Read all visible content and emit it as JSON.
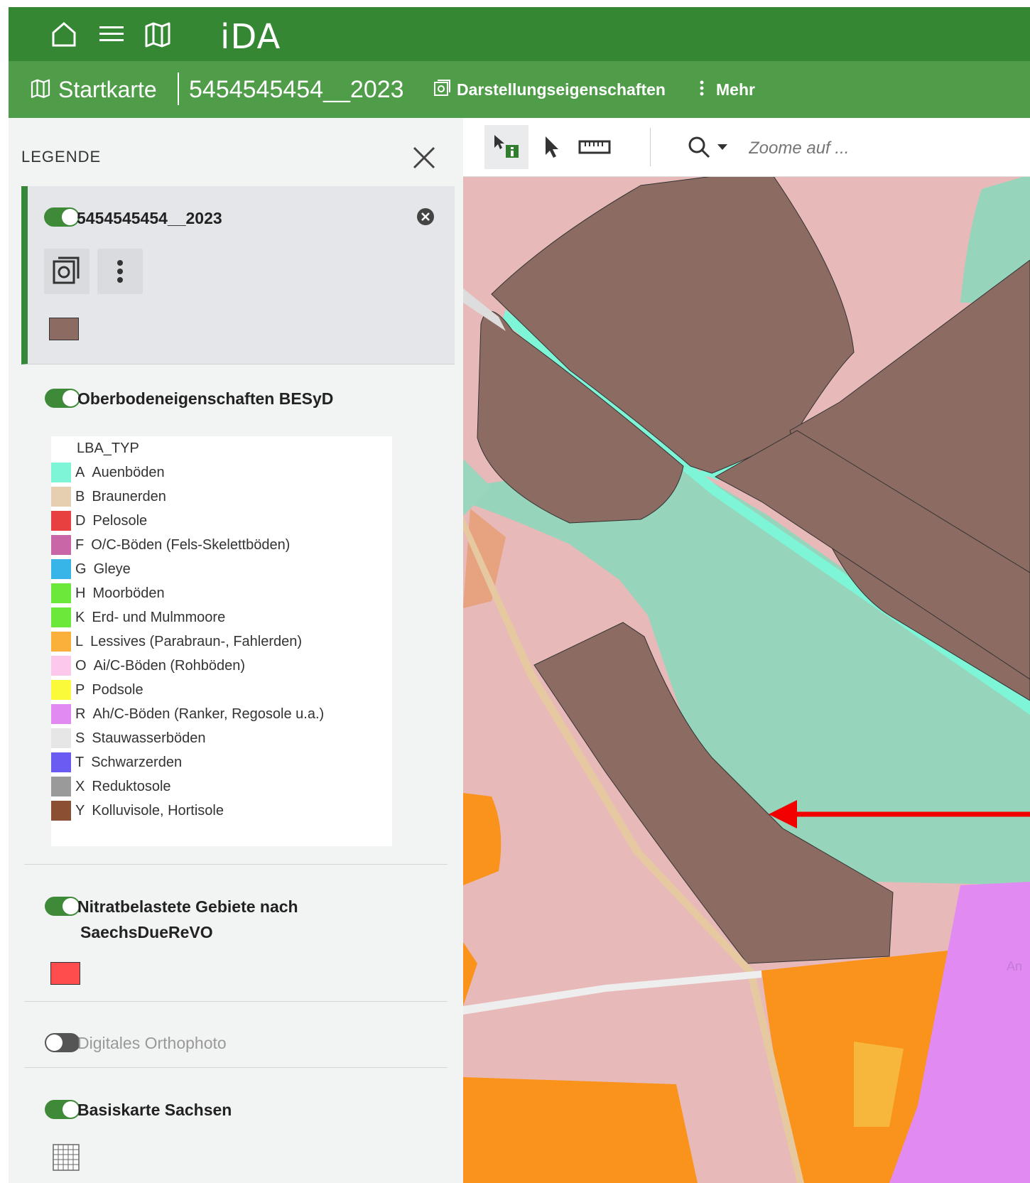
{
  "app": {
    "title": "iDA"
  },
  "topbar": {
    "home_icon": "home-icon",
    "menu_icon": "hamburger-menu-icon",
    "map_icon": "map-icon"
  },
  "subbar": {
    "startkarte": "Startkarte",
    "layer_name": "5454545454__2023",
    "darstellung": "Darstellungseigenschaften",
    "mehr": "Mehr"
  },
  "legend": {
    "title": "LEGENDE",
    "layers": [
      {
        "name": "5454545454__2023",
        "enabled": true,
        "swatch_color": "#8c6b62"
      },
      {
        "name": "Oberbodeneigenschaften BESyD",
        "enabled": true
      },
      {
        "name": "Nitratbelastete Gebiete nach",
        "name_line2": "SaechsDueReVO",
        "enabled": true,
        "swatch_color": "#ff4d4d"
      },
      {
        "name": "Digitales Orthophoto",
        "enabled": false
      },
      {
        "name": "Basiskarte Sachsen",
        "enabled": true
      }
    ],
    "soil_table": {
      "header": "LBA_TYP",
      "rows": [
        {
          "code": "A",
          "label": "Auenböden",
          "color": "#7ff5d8"
        },
        {
          "code": "B",
          "label": "Braunerden",
          "color": "#e5cfb0"
        },
        {
          "code": "D",
          "label": "Pelosole",
          "color": "#e84040"
        },
        {
          "code": "F",
          "label": "O/C-Böden (Fels-Skelettböden)",
          "color": "#c966a8"
        },
        {
          "code": "G",
          "label": "Gleye",
          "color": "#38b5e8"
        },
        {
          "code": "H",
          "label": "Moorböden",
          "color": "#6ce83a"
        },
        {
          "code": "K",
          "label": "Erd- und Mulmmoore",
          "color": "#6ce83a"
        },
        {
          "code": "L",
          "label": "Lessives (Parabraun-, Fahlerden)",
          "color": "#fbb03b"
        },
        {
          "code": "O",
          "label": "Ai/C-Böden (Rohböden)",
          "color": "#fcc8ec"
        },
        {
          "code": "P",
          "label": "Podsole",
          "color": "#fbfa3a"
        },
        {
          "code": "R",
          "label": "Ah/C-Böden (Ranker, Regosole u.a.)",
          "color": "#e08af2"
        },
        {
          "code": "S",
          "label": "Stauwasserböden",
          "color": "#e6e6e6"
        },
        {
          "code": "T",
          "label": "Schwarzerden",
          "color": "#6a5cf2"
        },
        {
          "code": "X",
          "label": "Reduktosole",
          "color": "#9a9a9a"
        },
        {
          "code": "Y",
          "label": "Kolluvisole, Hortisole",
          "color": "#8b4f33"
        }
      ]
    }
  },
  "map": {
    "search_placeholder": "Zoome auf ...",
    "street_label": "An"
  }
}
